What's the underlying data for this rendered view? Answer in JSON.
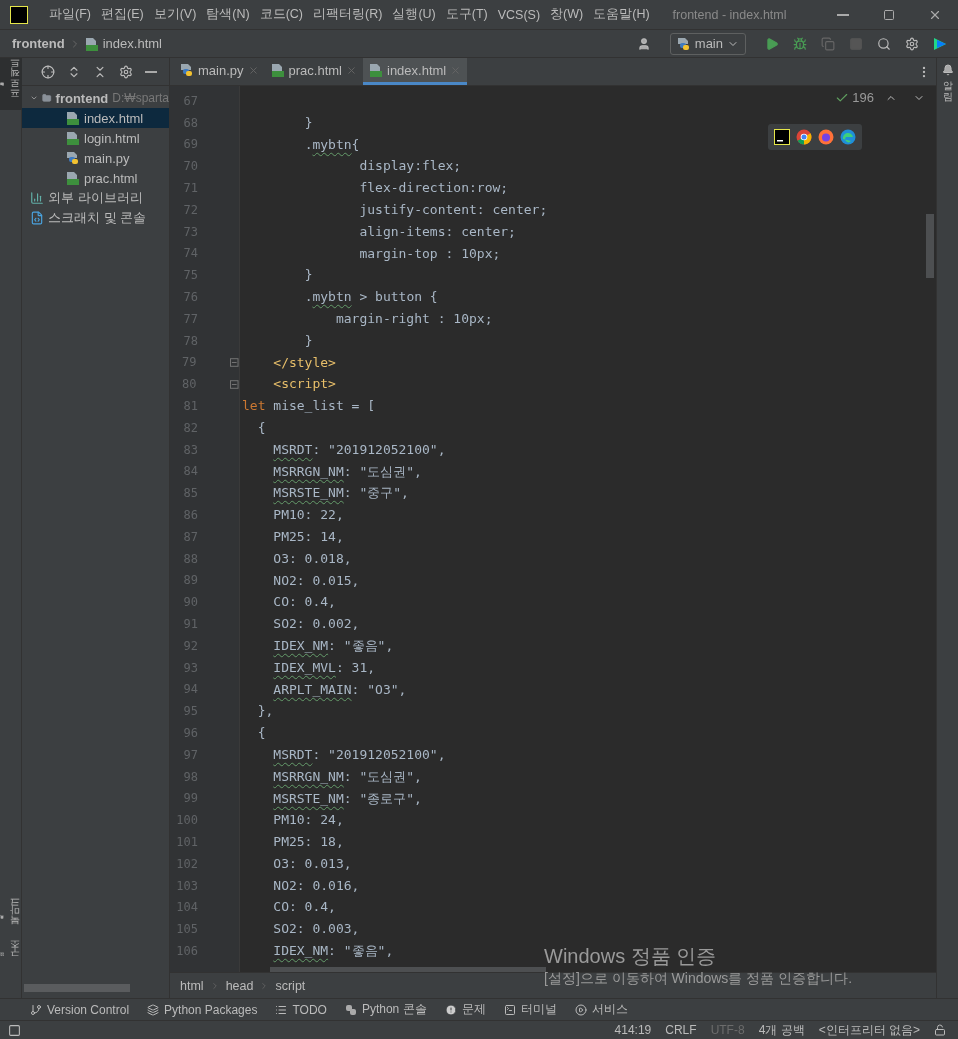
{
  "window": {
    "title": "frontend - index.html"
  },
  "menu": [
    "파일(F)",
    "편집(E)",
    "보기(V)",
    "탐색(N)",
    "코드(C)",
    "리팩터링(R)",
    "실행(U)",
    "도구(T)",
    "VCS(S)",
    "창(W)",
    "도움말(H)"
  ],
  "navbar": {
    "project": "frontend",
    "file": "index.html",
    "run_config": "main"
  },
  "left_strip": [
    {
      "label": "프로젝트",
      "kind": "project",
      "selected": true
    },
    {
      "label": "북마크",
      "kind": "bookmarks",
      "selected": false
    },
    {
      "label": "구조",
      "kind": "structure",
      "selected": false
    }
  ],
  "right_strip": [
    {
      "label": "알림",
      "kind": "notifications"
    }
  ],
  "project_tree": [
    {
      "label": "frontend",
      "path": "D:₩sparta",
      "kind": "folder",
      "expanded": true,
      "selected": false,
      "children": [
        {
          "label": "index.html",
          "kind": "html",
          "selected": true
        },
        {
          "label": "login.html",
          "kind": "html",
          "selected": false
        },
        {
          "label": "main.py",
          "kind": "python",
          "selected": false
        },
        {
          "label": "prac.html",
          "kind": "html",
          "selected": false
        }
      ]
    },
    {
      "label": "외부 라이브러리",
      "kind": "libraries",
      "selected": false
    },
    {
      "label": "스크래치 및 콘솔",
      "kind": "scratches",
      "selected": false
    }
  ],
  "editor_tabs": [
    {
      "label": "main.py",
      "kind": "python",
      "selected": false
    },
    {
      "label": "prac.html",
      "kind": "html",
      "selected": false
    },
    {
      "label": "index.html",
      "kind": "html",
      "selected": true
    }
  ],
  "inspection_count": "196",
  "code_lines": [
    {
      "number": "67"
    },
    {
      "number": "68",
      "tokens": [
        {
          "text": "        }",
          "kind": "plain"
        }
      ]
    },
    {
      "number": "69",
      "tokens": [
        {
          "text": "        .",
          "kind": "plain"
        },
        {
          "text": "mybtn",
          "kind": "typo"
        },
        {
          "text": "{",
          "kind": "plain"
        }
      ]
    },
    {
      "number": "70",
      "tokens": [
        {
          "text": "               display:flex;",
          "kind": "plain"
        }
      ]
    },
    {
      "number": "71",
      "tokens": [
        {
          "text": "               flex-direction:row;",
          "kind": "plain"
        }
      ]
    },
    {
      "number": "72",
      "tokens": [
        {
          "text": "               justify-content: center;",
          "kind": "plain"
        }
      ]
    },
    {
      "number": "73",
      "tokens": [
        {
          "text": "               align-items: center;",
          "kind": "plain"
        }
      ]
    },
    {
      "number": "74",
      "tokens": [
        {
          "text": "               margin-top : 10px;",
          "kind": "plain"
        }
      ]
    },
    {
      "number": "75",
      "tokens": [
        {
          "text": "        }",
          "kind": "plain"
        }
      ]
    },
    {
      "number": "76",
      "tokens": [
        {
          "text": "        .",
          "kind": "plain"
        },
        {
          "text": "mybtn",
          "kind": "typo"
        },
        {
          "text": " > button {",
          "kind": "plain"
        }
      ]
    },
    {
      "number": "77",
      "tokens": [
        {
          "text": "            margin-right : 10px;",
          "kind": "plain"
        }
      ]
    },
    {
      "number": "78",
      "tokens": [
        {
          "text": "        }",
          "kind": "plain"
        }
      ]
    },
    {
      "number": "79",
      "fold": true,
      "tokens": [
        {
          "text": "    </style>",
          "kind": "tag"
        }
      ]
    },
    {
      "number": "80",
      "fold": true,
      "tokens": [
        {
          "text": "    <script>",
          "kind": "tag"
        }
      ]
    },
    {
      "number": "81",
      "tokens": [
        {
          "text": "let",
          "kind": "keyword"
        },
        {
          "text": " mise_list = [",
          "kind": "plain"
        }
      ]
    },
    {
      "number": "82",
      "tokens": [
        {
          "text": "  {",
          "kind": "plain"
        }
      ]
    },
    {
      "number": "83",
      "tokens": [
        {
          "text": "    MSRDT",
          "kind": "typo"
        },
        {
          "text": ": \"201912052100\",",
          "kind": "plain"
        }
      ]
    },
    {
      "number": "84",
      "tokens": [
        {
          "text": "    MSRRGN_NM",
          "kind": "typo"
        },
        {
          "text": ": \"도심권\",",
          "kind": "plain"
        }
      ]
    },
    {
      "number": "85",
      "tokens": [
        {
          "text": "    MSRSTE_NM",
          "kind": "typo"
        },
        {
          "text": ": \"중구\",",
          "kind": "plain"
        }
      ]
    },
    {
      "number": "86",
      "tokens": [
        {
          "text": "    PM10: 22,",
          "kind": "plain"
        }
      ]
    },
    {
      "number": "87",
      "tokens": [
        {
          "text": "    PM25: 14,",
          "kind": "plain"
        }
      ]
    },
    {
      "number": "88",
      "tokens": [
        {
          "text": "    O3: 0.018,",
          "kind": "plain"
        }
      ]
    },
    {
      "number": "89",
      "tokens": [
        {
          "text": "    NO2: 0.015,",
          "kind": "plain"
        }
      ]
    },
    {
      "number": "90",
      "tokens": [
        {
          "text": "    CO: 0.4,",
          "kind": "plain"
        }
      ]
    },
    {
      "number": "91",
      "tokens": [
        {
          "text": "    SO2: 0.002,",
          "kind": "plain"
        }
      ]
    },
    {
      "number": "92",
      "tokens": [
        {
          "text": "    IDEX_NM",
          "kind": "typo"
        },
        {
          "text": ": \"좋음\",",
          "kind": "plain"
        }
      ]
    },
    {
      "number": "93",
      "tokens": [
        {
          "text": "    IDEX_MVL",
          "kind": "typo"
        },
        {
          "text": ": 31,",
          "kind": "plain"
        }
      ]
    },
    {
      "number": "94",
      "tokens": [
        {
          "text": "    ARPLT_MAIN",
          "kind": "typo"
        },
        {
          "text": ": \"O3\",",
          "kind": "plain"
        }
      ]
    },
    {
      "number": "95",
      "tokens": [
        {
          "text": "  },",
          "kind": "plain"
        }
      ]
    },
    {
      "number": "96",
      "tokens": [
        {
          "text": "  {",
          "kind": "plain"
        }
      ]
    },
    {
      "number": "97",
      "tokens": [
        {
          "text": "    MSRDT",
          "kind": "typo"
        },
        {
          "text": ": \"201912052100\",",
          "kind": "plain"
        }
      ]
    },
    {
      "number": "98",
      "tokens": [
        {
          "text": "    MSRRGN_NM",
          "kind": "typo"
        },
        {
          "text": ": \"도심권\",",
          "kind": "plain"
        }
      ]
    },
    {
      "number": "99",
      "tokens": [
        {
          "text": "    MSRSTE_NM",
          "kind": "typo"
        },
        {
          "text": ": \"종로구\",",
          "kind": "plain"
        }
      ]
    },
    {
      "number": "100",
      "tokens": [
        {
          "text": "    PM10: 24,",
          "kind": "plain"
        }
      ]
    },
    {
      "number": "101",
      "tokens": [
        {
          "text": "    PM25: 18,",
          "kind": "plain"
        }
      ]
    },
    {
      "number": "102",
      "tokens": [
        {
          "text": "    O3: 0.013,",
          "kind": "plain"
        }
      ]
    },
    {
      "number": "103",
      "tokens": [
        {
          "text": "    NO2: 0.016,",
          "kind": "plain"
        }
      ]
    },
    {
      "number": "104",
      "tokens": [
        {
          "text": "    CO: 0.4,",
          "kind": "plain"
        }
      ]
    },
    {
      "number": "105",
      "tokens": [
        {
          "text": "    SO2: 0.003,",
          "kind": "plain"
        }
      ]
    },
    {
      "number": "106",
      "tokens": [
        {
          "text": "    IDEX_NM",
          "kind": "typo"
        },
        {
          "text": ": \"좋음\",",
          "kind": "plain"
        }
      ]
    }
  ],
  "breadcrumbs": [
    "html",
    "head",
    "script"
  ],
  "tool_windows": [
    {
      "label": "Version Control",
      "kind": "vcs"
    },
    {
      "label": "Python Packages",
      "kind": "packages"
    },
    {
      "label": "TODO",
      "kind": "todo"
    },
    {
      "label": "Python 콘솔",
      "kind": "python"
    },
    {
      "label": "문제",
      "kind": "problems"
    },
    {
      "label": "터미널",
      "kind": "terminal"
    },
    {
      "label": "서비스",
      "kind": "services"
    }
  ],
  "status_bar": [
    {
      "text": "414:19",
      "disabled": false
    },
    {
      "text": "CRLF",
      "disabled": false
    },
    {
      "text": "UTF-8",
      "disabled": true
    },
    {
      "text": "4개 공백",
      "disabled": false
    },
    {
      "text": "<인터프리터 없음>",
      "disabled": false
    }
  ],
  "activation_notice": {
    "title": "Windows 정품 인증",
    "message": "[설정]으로 이동하여 Windows를 정품 인증합니다."
  }
}
